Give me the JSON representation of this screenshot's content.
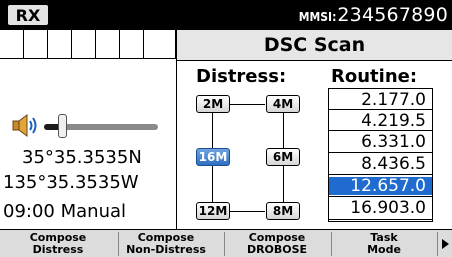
{
  "status": {
    "rx_label": "RX",
    "mmsi_label": "MMSI:",
    "mmsi_value": "234567890"
  },
  "screen_title": "DSC Scan",
  "left_panel": {
    "volume_level": 0.16,
    "latitude": "35°35.3535N",
    "longitude": "135°35.3535W",
    "time_mode": "09:00 Manual"
  },
  "distress": {
    "header": "Distress:",
    "channels": [
      {
        "label": "2M",
        "selected": false
      },
      {
        "label": "4M",
        "selected": false
      },
      {
        "label": "16M",
        "selected": true
      },
      {
        "label": "6M",
        "selected": false
      },
      {
        "label": "12M",
        "selected": false
      },
      {
        "label": "8M",
        "selected": false
      }
    ]
  },
  "routine": {
    "header": "Routine:",
    "frequencies": [
      "2.177.0",
      "4.219.5",
      "6.331.0",
      "8.436.5",
      "12.657.0",
      "16.903.0"
    ],
    "selected_index": 4
  },
  "softkeys": [
    {
      "line1": "Compose",
      "line2": "Distress"
    },
    {
      "line1": "Compose",
      "line2": "Non-Distress"
    },
    {
      "line1": "Compose",
      "line2": "DROBOSE"
    },
    {
      "line1": "Task",
      "line2": "Mode"
    }
  ],
  "icons": {
    "volume": "speaker-icon",
    "next_page": "triangle-right-icon"
  }
}
